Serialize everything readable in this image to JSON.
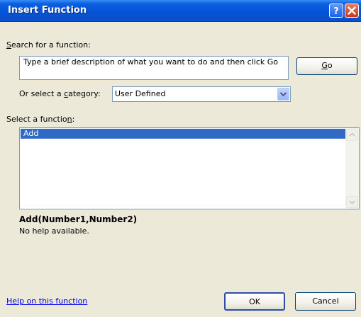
{
  "window": {
    "title": "Insert Function",
    "help_button": "?",
    "close_button": "X"
  },
  "search": {
    "label_prefix": "",
    "label_accel": "S",
    "label_rest": "earch for a function:",
    "value": "Type a brief description of what you want to do and then click Go",
    "go_button": {
      "accel": "G",
      "rest": "o"
    }
  },
  "category": {
    "label_prefix": "Or select a ",
    "label_accel": "c",
    "label_rest": "ategory:",
    "selected": "User Defined"
  },
  "function_list": {
    "label_prefix": "Select a functio",
    "label_accel": "n",
    "label_rest": ":",
    "items": [
      "Add"
    ],
    "selected_index": 0
  },
  "details": {
    "signature": "Add(Number1,Number2)",
    "help": "No help available."
  },
  "footer": {
    "help_link": "Help on this function",
    "ok_button": "OK",
    "cancel_button": "Cancel"
  }
}
